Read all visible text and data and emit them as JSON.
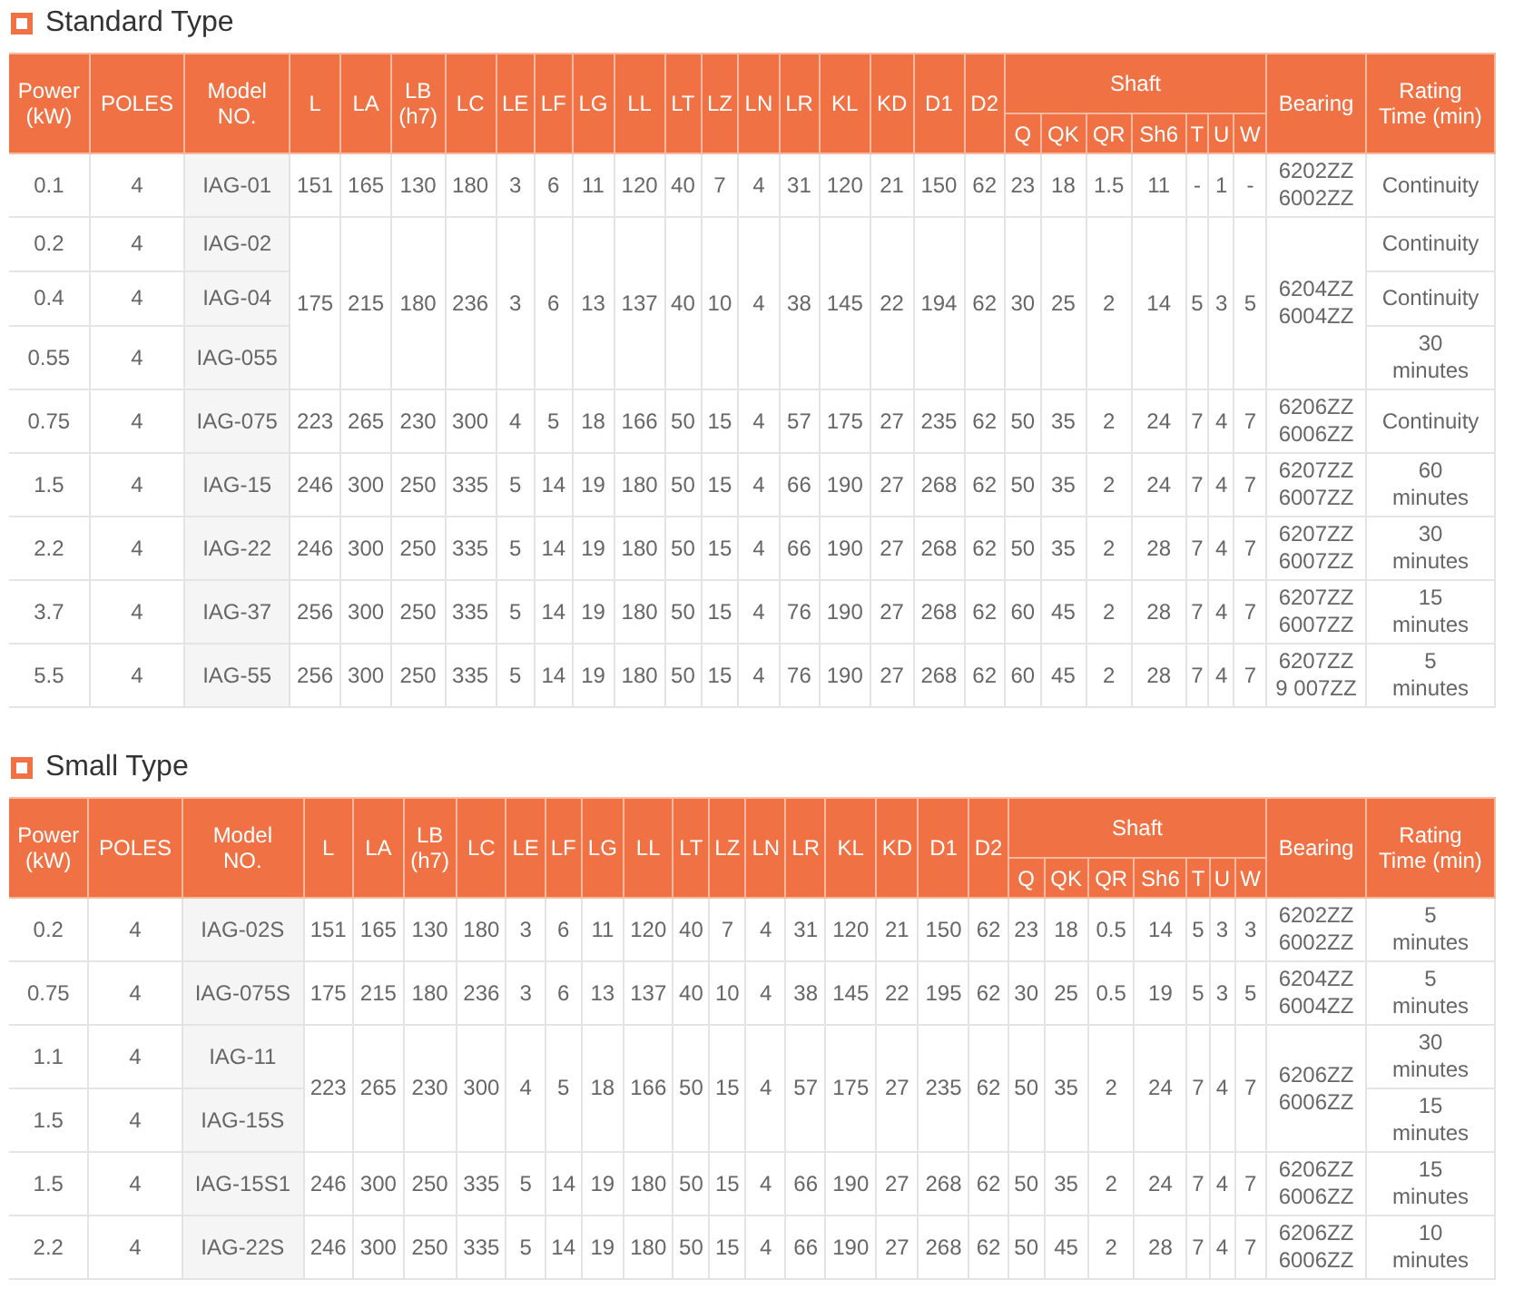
{
  "sections": [
    {
      "title": "Standard Type",
      "table": {
        "columns": [
          "Power\n(kW)",
          "POLES",
          "Model\nNO.",
          "L",
          "LA",
          "LB\n(h7)",
          "LC",
          "LE",
          "LF",
          "LG",
          "LL",
          "LT",
          "LZ",
          "LN",
          "LR",
          "KL",
          "KD",
          "D1",
          "D2"
        ],
        "shaft": {
          "label": "Shaft",
          "columns": [
            "Q",
            "QK",
            "QR",
            "Sh6",
            "T",
            "U",
            "W"
          ]
        },
        "tail_columns": [
          "Bearing",
          "Rating\nTime (min)"
        ],
        "groups": [
          {
            "rows": [
              {
                "power": "0.1",
                "poles": "4",
                "model": "IAG-01",
                "rating": "Continuity"
              }
            ],
            "dims": [
              "151",
              "165",
              "130",
              "180",
              "3",
              "6",
              "11",
              "120",
              "40",
              "7",
              "4",
              "31",
              "120",
              "21",
              "150",
              "62",
              "23",
              "18",
              "1.5",
              "11",
              "-",
              "1",
              "-"
            ],
            "bearing": "6202ZZ\n6002ZZ"
          },
          {
            "rows": [
              {
                "power": "0.2",
                "poles": "4",
                "model": "IAG-02",
                "rating": "Continuity"
              },
              {
                "power": "0.4",
                "poles": "4",
                "model": "IAG-04",
                "rating": "Continuity"
              },
              {
                "power": "0.55",
                "poles": "4",
                "model": "IAG-055",
                "rating": "30\nminutes"
              }
            ],
            "dims": [
              "175",
              "215",
              "180",
              "236",
              "3",
              "6",
              "13",
              "137",
              "40",
              "10",
              "4",
              "38",
              "145",
              "22",
              "194",
              "62",
              "30",
              "25",
              "2",
              "14",
              "5",
              "3",
              "5"
            ],
            "bearing": "6204ZZ\n6004ZZ"
          },
          {
            "rows": [
              {
                "power": "0.75",
                "poles": "4",
                "model": "IAG-075",
                "rating": "Continuity"
              }
            ],
            "dims": [
              "223",
              "265",
              "230",
              "300",
              "4",
              "5",
              "18",
              "166",
              "50",
              "15",
              "4",
              "57",
              "175",
              "27",
              "235",
              "62",
              "50",
              "35",
              "2",
              "24",
              "7",
              "4",
              "7"
            ],
            "bearing": "6206ZZ\n6006ZZ"
          },
          {
            "rows": [
              {
                "power": "1.5",
                "poles": "4",
                "model": "IAG-15",
                "rating": "60\nminutes"
              }
            ],
            "dims": [
              "246",
              "300",
              "250",
              "335",
              "5",
              "14",
              "19",
              "180",
              "50",
              "15",
              "4",
              "66",
              "190",
              "27",
              "268",
              "62",
              "50",
              "35",
              "2",
              "24",
              "7",
              "4",
              "7"
            ],
            "bearing": "6207ZZ\n6007ZZ"
          },
          {
            "rows": [
              {
                "power": "2.2",
                "poles": "4",
                "model": "IAG-22",
                "rating": "30\nminutes"
              }
            ],
            "dims": [
              "246",
              "300",
              "250",
              "335",
              "5",
              "14",
              "19",
              "180",
              "50",
              "15",
              "4",
              "66",
              "190",
              "27",
              "268",
              "62",
              "50",
              "35",
              "2",
              "28",
              "7",
              "4",
              "7"
            ],
            "bearing": "6207ZZ\n6007ZZ"
          },
          {
            "rows": [
              {
                "power": "3.7",
                "poles": "4",
                "model": "IAG-37",
                "rating": "15\nminutes"
              }
            ],
            "dims": [
              "256",
              "300",
              "250",
              "335",
              "5",
              "14",
              "19",
              "180",
              "50",
              "15",
              "4",
              "76",
              "190",
              "27",
              "268",
              "62",
              "60",
              "45",
              "2",
              "28",
              "7",
              "4",
              "7"
            ],
            "bearing": "6207ZZ\n6007ZZ"
          },
          {
            "rows": [
              {
                "power": "5.5",
                "poles": "4",
                "model": "IAG-55",
                "rating": "5\nminutes"
              }
            ],
            "dims": [
              "256",
              "300",
              "250",
              "335",
              "5",
              "14",
              "19",
              "180",
              "50",
              "15",
              "4",
              "76",
              "190",
              "27",
              "268",
              "62",
              "60",
              "45",
              "2",
              "28",
              "7",
              "4",
              "7"
            ],
            "bearing": "6207ZZ\n9 007ZZ"
          }
        ]
      }
    },
    {
      "title": "Small Type",
      "table": {
        "columns": [
          "Power\n(kW)",
          "POLES",
          "Model\nNO.",
          "L",
          "LA",
          "LB\n(h7)",
          "LC",
          "LE",
          "LF",
          "LG",
          "LL",
          "LT",
          "LZ",
          "LN",
          "LR",
          "KL",
          "KD",
          "D1",
          "D2"
        ],
        "shaft": {
          "label": "Shaft",
          "columns": [
            "Q",
            "QK",
            "QR",
            "Sh6",
            "T",
            "U",
            "W"
          ]
        },
        "tail_columns": [
          "Bearing",
          "Rating\nTime (min)"
        ],
        "groups": [
          {
            "rows": [
              {
                "power": "0.2",
                "poles": "4",
                "model": "IAG-02S",
                "rating": "5\nminutes"
              }
            ],
            "dims": [
              "151",
              "165",
              "130",
              "180",
              "3",
              "6",
              "11",
              "120",
              "40",
              "7",
              "4",
              "31",
              "120",
              "21",
              "150",
              "62",
              "23",
              "18",
              "0.5",
              "14",
              "5",
              "3",
              "3"
            ],
            "bearing": "6202ZZ\n6002ZZ"
          },
          {
            "rows": [
              {
                "power": "0.75",
                "poles": "4",
                "model": "IAG-075S",
                "rating": "5\nminutes"
              }
            ],
            "dims": [
              "175",
              "215",
              "180",
              "236",
              "3",
              "6",
              "13",
              "137",
              "40",
              "10",
              "4",
              "38",
              "145",
              "22",
              "195",
              "62",
              "30",
              "25",
              "0.5",
              "19",
              "5",
              "3",
              "5"
            ],
            "bearing": "6204ZZ\n6004ZZ"
          },
          {
            "rows": [
              {
                "power": "1.1",
                "poles": "4",
                "model": "IAG-11",
                "rating": "30\nminutes"
              },
              {
                "power": "1.5",
                "poles": "4",
                "model": "IAG-15S",
                "rating": "15\nminutes"
              }
            ],
            "dims": [
              "223",
              "265",
              "230",
              "300",
              "4",
              "5",
              "18",
              "166",
              "50",
              "15",
              "4",
              "57",
              "175",
              "27",
              "235",
              "62",
              "50",
              "35",
              "2",
              "24",
              "7",
              "4",
              "7"
            ],
            "bearing": "6206ZZ\n6006ZZ"
          },
          {
            "rows": [
              {
                "power": "1.5",
                "poles": "4",
                "model": "IAG-15S1",
                "rating": "15\nminutes"
              }
            ],
            "dims": [
              "246",
              "300",
              "250",
              "335",
              "5",
              "14",
              "19",
              "180",
              "50",
              "15",
              "4",
              "66",
              "190",
              "27",
              "268",
              "62",
              "50",
              "35",
              "2",
              "24",
              "7",
              "4",
              "7"
            ],
            "bearing": "6206ZZ\n6006ZZ"
          },
          {
            "rows": [
              {
                "power": "2.2",
                "poles": "4",
                "model": "IAG-22S",
                "rating": "10\nminutes"
              }
            ],
            "dims": [
              "246",
              "300",
              "250",
              "335",
              "5",
              "14",
              "19",
              "180",
              "50",
              "15",
              "4",
              "66",
              "190",
              "27",
              "268",
              "62",
              "50",
              "45",
              "2",
              "28",
              "7",
              "4",
              "7"
            ],
            "bearing": "6206ZZ\n6006ZZ"
          }
        ]
      }
    }
  ]
}
